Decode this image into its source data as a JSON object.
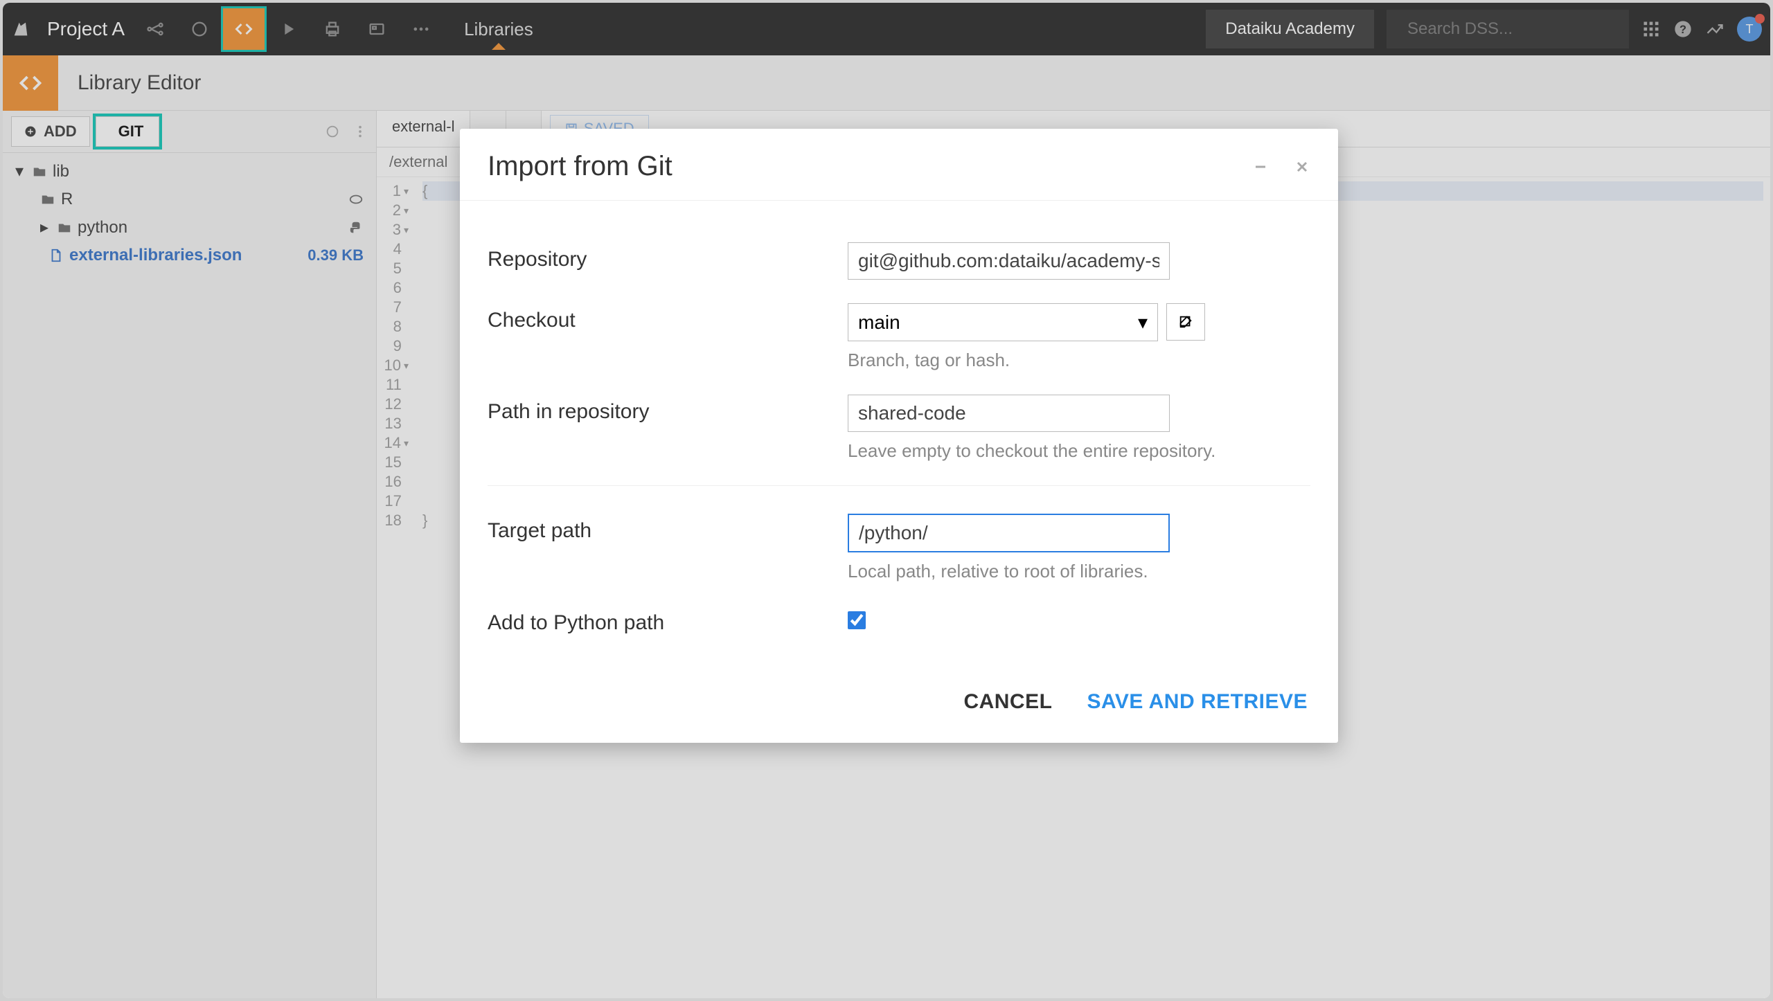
{
  "topnav": {
    "project": "Project A",
    "libraries_label": "Libraries",
    "academy": "Dataiku Academy",
    "search_placeholder": "Search DSS...",
    "avatar_initial": "T"
  },
  "subheader": {
    "title": "Library Editor"
  },
  "sidebar": {
    "add_label": "ADD",
    "git_label": "GIT",
    "tree": {
      "lib": "lib",
      "r": "R",
      "python": "python",
      "file": "external-libraries.json",
      "file_size": "0.39 KB"
    }
  },
  "content": {
    "tab1": "external-l",
    "path": "/external",
    "saved": "SAVED"
  },
  "editor": {
    "lines": [
      {
        "n": "1",
        "fold": "▾",
        "code": "{"
      },
      {
        "n": "2",
        "fold": "▾",
        "code": ""
      },
      {
        "n": "3",
        "fold": "▾",
        "code": ""
      },
      {
        "n": "4",
        "fold": "",
        "code": ""
      },
      {
        "n": "5",
        "fold": "",
        "code": ""
      },
      {
        "n": "6",
        "fold": "",
        "code": ""
      },
      {
        "n": "7",
        "fold": "",
        "code": ""
      },
      {
        "n": "8",
        "fold": "",
        "code": ""
      },
      {
        "n": "9",
        "fold": "",
        "code": ""
      },
      {
        "n": "10",
        "fold": "▾",
        "code": ""
      },
      {
        "n": "11",
        "fold": "",
        "code": ""
      },
      {
        "n": "12",
        "fold": "",
        "code": ""
      },
      {
        "n": "13",
        "fold": "",
        "code": ""
      },
      {
        "n": "14",
        "fold": "▾",
        "code": ""
      },
      {
        "n": "15",
        "fold": "",
        "code": ""
      },
      {
        "n": "16",
        "fold": "",
        "code": ""
      },
      {
        "n": "17",
        "fold": "",
        "code": ""
      },
      {
        "n": "18",
        "fold": "",
        "code": "}"
      }
    ]
  },
  "modal": {
    "title": "Import from Git",
    "repository_label": "Repository",
    "repository_value": "git@github.com:dataiku/academy-s",
    "checkout_label": "Checkout",
    "checkout_value": "main",
    "checkout_help": "Branch, tag or hash.",
    "path_label": "Path in repository",
    "path_value": "shared-code",
    "path_help": "Leave empty to checkout the entire repository.",
    "target_label": "Target path",
    "target_value": "/python/",
    "target_help": "Local path, relative to root of libraries.",
    "add_python_label": "Add to Python path",
    "cancel": "CANCEL",
    "save": "SAVE AND RETRIEVE"
  }
}
